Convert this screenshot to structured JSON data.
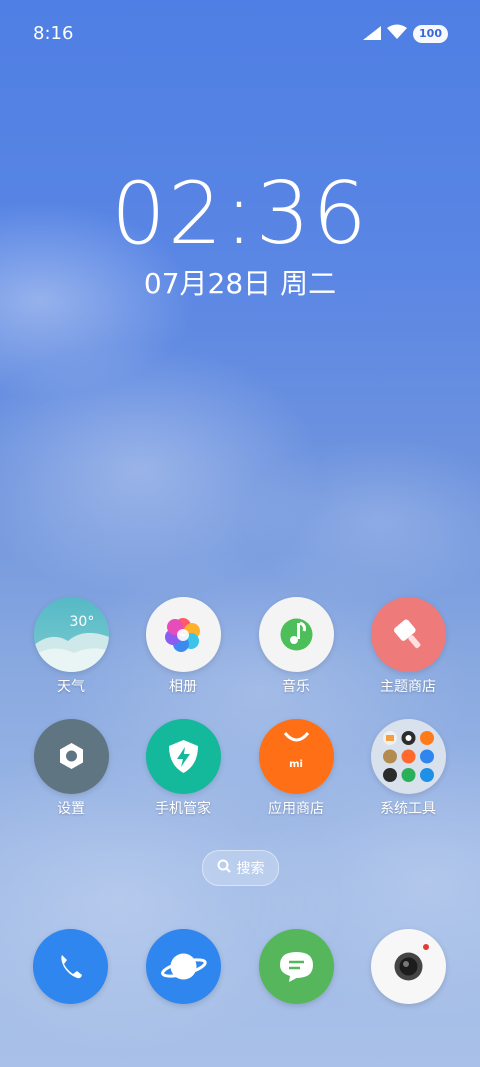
{
  "status_bar": {
    "time": "8:16",
    "battery": "100"
  },
  "lockscreen": {
    "clock": "02:36",
    "date": "07月28日 周二"
  },
  "apps": [
    {
      "label": "天气",
      "temp": "30°"
    },
    {
      "label": "相册"
    },
    {
      "label": "音乐"
    },
    {
      "label": "主题商店"
    },
    {
      "label": "设置"
    },
    {
      "label": "手机管家"
    },
    {
      "label": "应用商店",
      "logo": "mi"
    },
    {
      "label": "系统工具"
    }
  ],
  "search": {
    "label": "搜索"
  },
  "dock": [
    "phone-icon",
    "browser-icon",
    "messages-icon",
    "camera-icon"
  ],
  "colors": {
    "weather": "#5dc3c8",
    "gallery_bg": "#f4f4f4",
    "music_bg": "#f4f4f4",
    "theme_store": "#ef7a7a",
    "settings": "#5f7682",
    "security": "#14b89a",
    "app_store": "#ff6f16",
    "phone": "#2f86ee",
    "browser": "#2f86ee",
    "messages": "#56b65c",
    "camera_bg": "#f7f7f7"
  }
}
